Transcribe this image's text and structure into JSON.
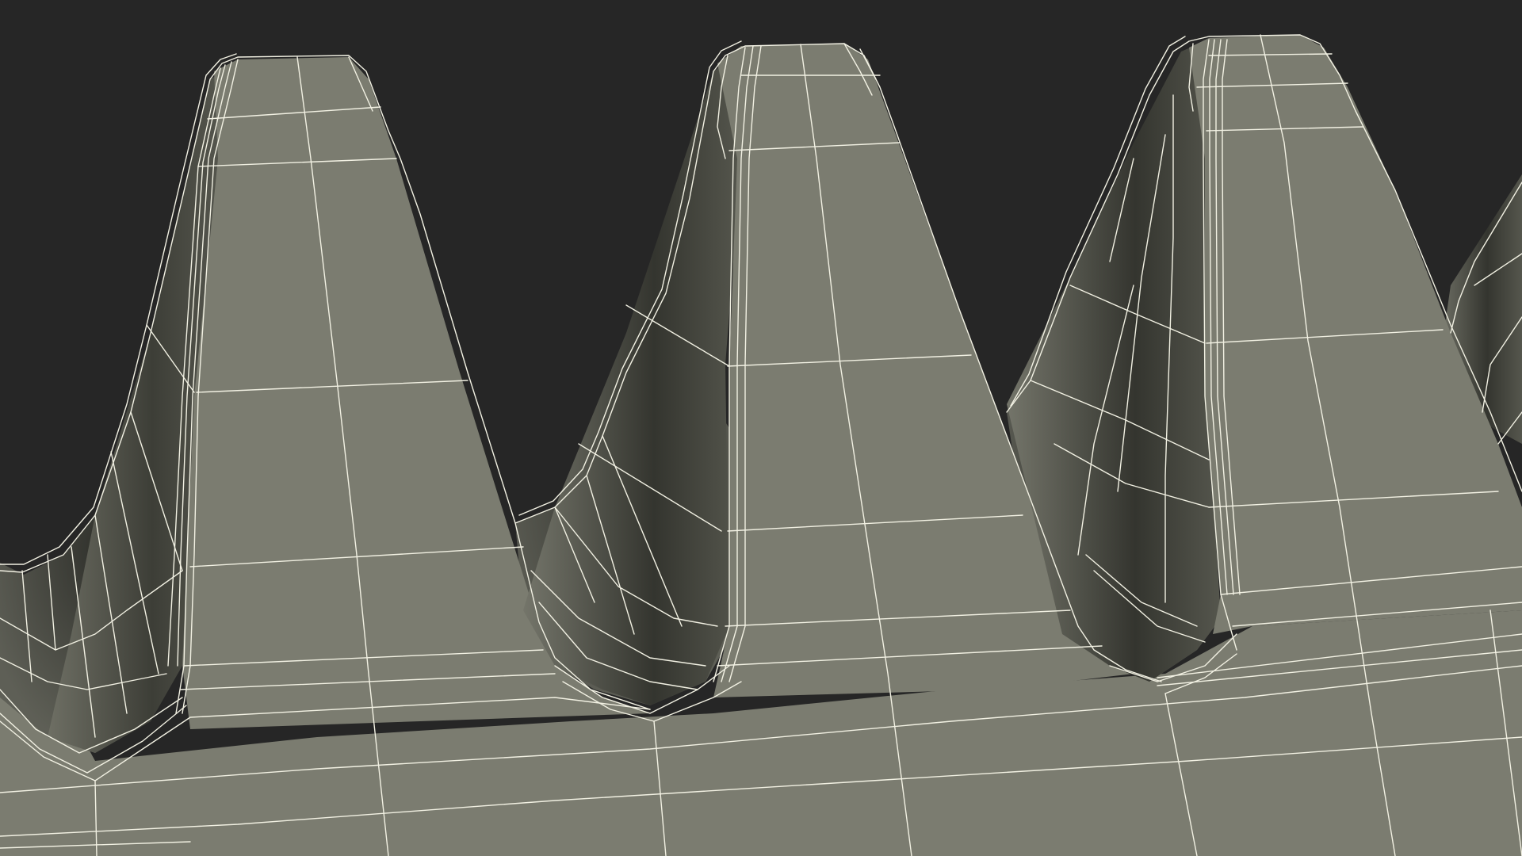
{
  "scene": {
    "subject": "gear-rack-teeth-wireframe",
    "tooth_count_visible": 4,
    "colors": {
      "background": "#262626",
      "surface": "#7b7c70",
      "surface_dark": "#3a3b34",
      "wireframe": "#f2f1e3"
    }
  }
}
